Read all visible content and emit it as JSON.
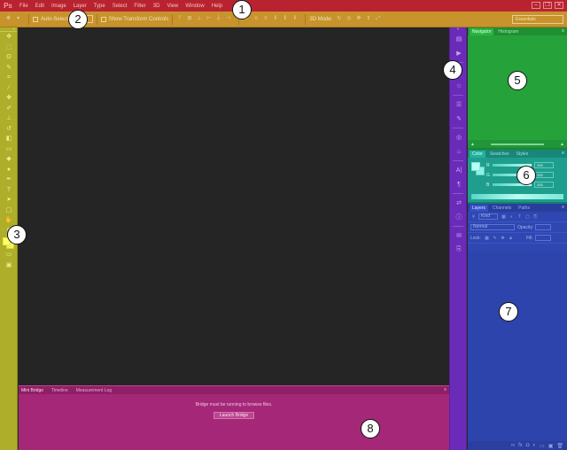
{
  "menubar": {
    "logo": "Ps",
    "items": [
      "File",
      "Edit",
      "Image",
      "Layer",
      "Type",
      "Select",
      "Filter",
      "3D",
      "View",
      "Window",
      "Help"
    ],
    "window_controls": [
      "–",
      "❐",
      "✕"
    ],
    "color": "#b8232f"
  },
  "options_bar": {
    "auto_select_label": "Auto-Select:",
    "auto_select_value": "Layer",
    "transform_label": "Show Transform Controls",
    "mode_label": "3D Mode:",
    "workspace_value": "Essentials",
    "color": "#c8932c"
  },
  "tools_panel": {
    "tools": [
      "move-tool-icon",
      "marquee-tool-icon",
      "lasso-tool-icon",
      "quick-select-tool-icon",
      "crop-tool-icon",
      "eyedropper-tool-icon",
      "healing-brush-tool-icon",
      "brush-tool-icon",
      "clone-stamp-tool-icon",
      "history-brush-tool-icon",
      "eraser-tool-icon",
      "gradient-tool-icon",
      "blur-tool-icon",
      "dodge-tool-icon",
      "pen-tool-icon",
      "type-tool-icon",
      "path-select-tool-icon",
      "shape-tool-icon",
      "hand-tool-icon",
      "zoom-tool-icon"
    ],
    "tool_glyphs": [
      "✥",
      "⬚",
      "ʘ",
      "✎",
      "⌗",
      "⁄",
      "✚",
      "✐",
      "⊥",
      "↺",
      "◧",
      "▭",
      "◆",
      "●",
      "✒",
      "T",
      "➤",
      "▢",
      "✋",
      "⚲"
    ],
    "color": "#aeae2a"
  },
  "dock": {
    "icons": [
      "history-icon",
      "actions-icon",
      "adjustments-icon",
      "styles-icon",
      "properties-icon",
      "brush-icon",
      "clone-source-icon",
      "tool-presets-icon",
      "character-icon",
      "paragraph-icon",
      "paths-icon",
      "info-icon",
      "notes-icon",
      "layer-comps-icon"
    ],
    "glyphs": [
      "▤",
      "▶",
      "◐",
      "☆",
      "☰",
      "✎",
      "◎",
      "⌂",
      "A|",
      "¶",
      "⇄",
      "ⓘ",
      "✉",
      "⎘"
    ],
    "color": "#6a2cb8"
  },
  "navigator_panel": {
    "tabs": [
      "Navigator",
      "Histogram"
    ],
    "color": "#25a33a"
  },
  "color_panel": {
    "tabs": [
      "Color",
      "Swatches",
      "Styles"
    ],
    "channels": [
      {
        "label": "R",
        "value": "255"
      },
      {
        "label": "G",
        "value": "255"
      },
      {
        "label": "B",
        "value": "255"
      }
    ],
    "color": "#1f9e8d"
  },
  "layers_panel": {
    "tabs": [
      "Layers",
      "Channels",
      "Paths"
    ],
    "filter_value": "Kind",
    "blend_mode": "Normal",
    "opacity_label": "Opacity:",
    "lock_label": "Lock:",
    "fill_label": "Fill:",
    "color": "#2f47b0"
  },
  "bottom_panel": {
    "tabs": [
      "Mini Bridge",
      "Timeline",
      "Measurement Log"
    ],
    "message": "Bridge must be running to browse files.",
    "button_label": "Launch Bridge",
    "color": "#a52878"
  },
  "callouts": [
    "1",
    "2",
    "3",
    "4",
    "5",
    "6",
    "7",
    "8"
  ]
}
